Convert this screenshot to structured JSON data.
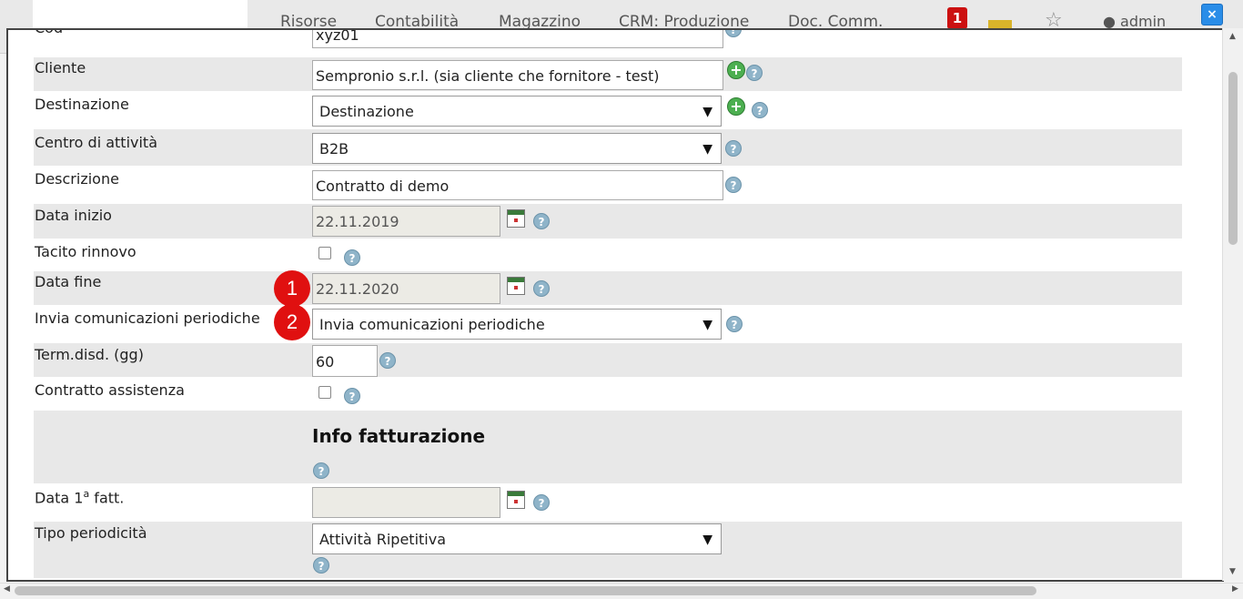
{
  "app": {
    "menu": [
      "Risorse",
      "Contabilità",
      "Magazzino",
      "CRM: Produzione",
      "Doc. Comm."
    ],
    "notifications_count": "1",
    "user": "admin",
    "close_label": "×"
  },
  "form": {
    "cod": {
      "value": "xyz01"
    },
    "cliente": {
      "label": "Cliente",
      "value": "Sempronio s.r.l.   (sia cliente che fornitore - test)"
    },
    "destinazione": {
      "label": "Destinazione",
      "value": "Destinazione"
    },
    "centro": {
      "label": "Centro di attività",
      "value": "B2B"
    },
    "descrizione": {
      "label": "Descrizione",
      "value": "Contratto di demo"
    },
    "data_inizio": {
      "label": "Data inizio",
      "value": "22.11.2019"
    },
    "tacito": {
      "label": "Tacito rinnovo",
      "checked": false
    },
    "data_fine": {
      "label": "Data fine",
      "value": "22.11.2020"
    },
    "invia": {
      "label": "Invia comunicazioni periodiche",
      "value": "Invia comunicazioni periodiche"
    },
    "term": {
      "label": "Term.disd. (gg)",
      "value": "60"
    },
    "assistenza": {
      "label": "Contratto assistenza",
      "checked": false
    },
    "info_fatt": {
      "title": "Info fatturazione"
    },
    "data_fatt": {
      "label_pre": "Data 1",
      "label_sup": "a",
      "label_post": " fatt.",
      "value": ""
    },
    "periodicita": {
      "label": "Tipo periodicità",
      "value": "Attività Ripetitiva"
    }
  },
  "annotations": {
    "step1": "1",
    "step2": "2"
  },
  "icons": {
    "help": "?",
    "add": "+",
    "caret": "▼"
  }
}
